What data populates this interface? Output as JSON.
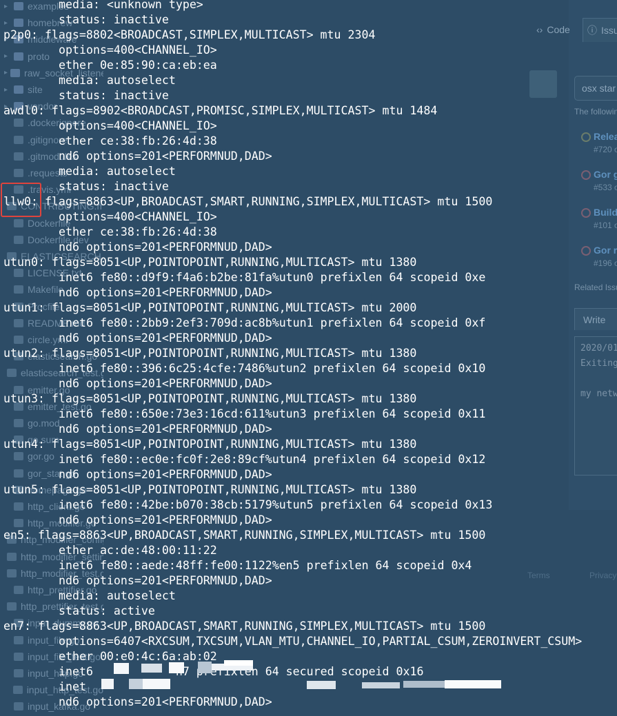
{
  "background": {
    "file_tree": [
      {
        "label": "examples",
        "type": "folder"
      },
      {
        "label": "homebrew",
        "type": "folder"
      },
      {
        "label": "middleware",
        "type": "folder"
      },
      {
        "label": "proto",
        "type": "folder"
      },
      {
        "label": "raw_socket_listener",
        "type": "folder"
      },
      {
        "label": "site",
        "type": "folder"
      },
      {
        "label": "vendor",
        "type": "folder"
      },
      {
        "label": ".dockerignore",
        "type": "file"
      },
      {
        "label": ".gitignore",
        "type": "file"
      },
      {
        "label": ".gitmodules",
        "type": "file"
      },
      {
        "label": ".requests",
        "type": "file"
      },
      {
        "label": ".travis.yml",
        "type": "file"
      },
      {
        "label": "CONTRIBUTING.md",
        "type": "file"
      },
      {
        "label": "Dockerfile",
        "type": "file"
      },
      {
        "label": "Dockerfile.dev",
        "type": "file"
      },
      {
        "label": "ELASTICSEARCH.md",
        "type": "file"
      },
      {
        "label": "LICENSE.txt",
        "type": "file"
      },
      {
        "label": "Makefile",
        "type": "file"
      },
      {
        "label": "Procfile",
        "type": "file"
      },
      {
        "label": "README.md",
        "type": "file"
      },
      {
        "label": "circle.yml",
        "type": "file"
      },
      {
        "label": "elasticsearch.go",
        "type": "file"
      },
      {
        "label": "elasticsearch_test.go",
        "type": "file"
      },
      {
        "label": "emitter.go",
        "type": "file"
      },
      {
        "label": "emitter_test.go",
        "type": "file"
      },
      {
        "label": "go.mod",
        "type": "file"
      },
      {
        "label": "go.sum",
        "type": "file"
      },
      {
        "label": "gor.go",
        "type": "file"
      },
      {
        "label": "gor_stat.go",
        "type": "file"
      },
      {
        "label": "homepage.go",
        "type": "file"
      },
      {
        "label": "http_client.go",
        "type": "file"
      },
      {
        "label": "http_modifier.go",
        "type": "file"
      },
      {
        "label": "http_modifier_config.go",
        "type": "file"
      },
      {
        "label": "http_modifier_settings.go",
        "type": "file"
      },
      {
        "label": "http_modifier_test.go",
        "type": "file"
      },
      {
        "label": "http_prettifier.go",
        "type": "file"
      },
      {
        "label": "http_prettifier_test.go",
        "type": "file"
      },
      {
        "label": "input_dummy.go",
        "type": "file"
      },
      {
        "label": "input_file.go",
        "type": "file"
      },
      {
        "label": "input_file_test.go",
        "type": "file"
      },
      {
        "label": "input_http.go",
        "type": "file"
      },
      {
        "label": "input_http_test.go",
        "type": "file"
      },
      {
        "label": "input_kafka.go",
        "type": "file"
      },
      {
        "label": "input_kafka_test.go",
        "type": "file"
      }
    ],
    "tabs": {
      "code": "Code",
      "issues": "Issu"
    },
    "search_value": "osx star",
    "following_text": "The followin",
    "issues": [
      {
        "title": "Relea",
        "number": "#720 o",
        "state": "open"
      },
      {
        "title": "Gor g",
        "number": "#533 o",
        "state": "closed"
      },
      {
        "title": "Build",
        "number": "#101 o",
        "state": "closed"
      },
      {
        "title": "Gor re",
        "number": "#196 o",
        "state": "closed"
      }
    ],
    "related_text": "Related Issu",
    "write_tab": "Write",
    "comment_lines": [
      "2020/01",
      "Exiting",
      "",
      "my netw"
    ],
    "footer": {
      "terms": "Terms",
      "privacy": "Privacy"
    }
  },
  "terminal": {
    "lines": [
      {
        "indent": true,
        "text": "media: <unknown type>"
      },
      {
        "indent": true,
        "text": "status: inactive"
      },
      {
        "indent": false,
        "text": "p2p0: flags=8802<BROADCAST,SIMPLEX,MULTICAST> mtu 2304"
      },
      {
        "indent": true,
        "text": "options=400<CHANNEL_IO>"
      },
      {
        "indent": true,
        "text": "ether 0e:85:90:ca:eb:ea"
      },
      {
        "indent": true,
        "text": "media: autoselect"
      },
      {
        "indent": true,
        "text": "status: inactive"
      },
      {
        "indent": false,
        "text": "awdl0: flags=8902<BROADCAST,PROMISC,SIMPLEX,MULTICAST> mtu 1484"
      },
      {
        "indent": true,
        "text": "options=400<CHANNEL_IO>"
      },
      {
        "indent": true,
        "text": "ether ce:38:fb:26:4d:38"
      },
      {
        "indent": true,
        "text": "nd6 options=201<PERFORMNUD,DAD>"
      },
      {
        "indent": true,
        "text": "media: autoselect"
      },
      {
        "indent": true,
        "text": "status: inactive"
      },
      {
        "indent": false,
        "text": "llw0: flags=8863<UP,BROADCAST,SMART,RUNNING,SIMPLEX,MULTICAST> mtu 1500"
      },
      {
        "indent": true,
        "text": "options=400<CHANNEL_IO>"
      },
      {
        "indent": true,
        "text": "ether ce:38:fb:26:4d:38"
      },
      {
        "indent": true,
        "text": "nd6 options=201<PERFORMNUD,DAD>"
      },
      {
        "indent": false,
        "text": "utun0: flags=8051<UP,POINTOPOINT,RUNNING,MULTICAST> mtu 1380"
      },
      {
        "indent": true,
        "text": "inet6 fe80::d9f9:f4a6:b2be:81fa%utun0 prefixlen 64 scopeid 0xe"
      },
      {
        "indent": true,
        "text": "nd6 options=201<PERFORMNUD,DAD>"
      },
      {
        "indent": false,
        "text": "utun1: flags=8051<UP,POINTOPOINT,RUNNING,MULTICAST> mtu 2000"
      },
      {
        "indent": true,
        "text": "inet6 fe80::2bb9:2ef3:709d:ac8b%utun1 prefixlen 64 scopeid 0xf"
      },
      {
        "indent": true,
        "text": "nd6 options=201<PERFORMNUD,DAD>"
      },
      {
        "indent": false,
        "text": "utun2: flags=8051<UP,POINTOPOINT,RUNNING,MULTICAST> mtu 1380"
      },
      {
        "indent": true,
        "text": "inet6 fe80::396:6c25:4cfe:7486%utun2 prefixlen 64 scopeid 0x10"
      },
      {
        "indent": true,
        "text": "nd6 options=201<PERFORMNUD,DAD>"
      },
      {
        "indent": false,
        "text": "utun3: flags=8051<UP,POINTOPOINT,RUNNING,MULTICAST> mtu 1380"
      },
      {
        "indent": true,
        "text": "inet6 fe80::650e:73e3:16cd:611%utun3 prefixlen 64 scopeid 0x11"
      },
      {
        "indent": true,
        "text": "nd6 options=201<PERFORMNUD,DAD>"
      },
      {
        "indent": false,
        "text": "utun4: flags=8051<UP,POINTOPOINT,RUNNING,MULTICAST> mtu 1380"
      },
      {
        "indent": true,
        "text": "inet6 fe80::ec0e:fc0f:2e8:89cf%utun4 prefixlen 64 scopeid 0x12"
      },
      {
        "indent": true,
        "text": "nd6 options=201<PERFORMNUD,DAD>"
      },
      {
        "indent": false,
        "text": "utun5: flags=8051<UP,POINTOPOINT,RUNNING,MULTICAST> mtu 1380"
      },
      {
        "indent": true,
        "text": "inet6 fe80::42be:b070:38cb:5179%utun5 prefixlen 64 scopeid 0x13"
      },
      {
        "indent": true,
        "text": "nd6 options=201<PERFORMNUD,DAD>"
      },
      {
        "indent": false,
        "text": "en5: flags=8863<UP,BROADCAST,SMART,RUNNING,SIMPLEX,MULTICAST> mtu 1500"
      },
      {
        "indent": true,
        "text": "ether ac:de:48:00:11:22"
      },
      {
        "indent": true,
        "text": "inet6 fe80::aede:48ff:fe00:1122%en5 prefixlen 64 scopeid 0x4"
      },
      {
        "indent": true,
        "text": "nd6 options=201<PERFORMNUD,DAD>"
      },
      {
        "indent": true,
        "text": "media: autoselect"
      },
      {
        "indent": true,
        "text": "status: active"
      },
      {
        "indent": false,
        "text": "en7: flags=8863<UP,BROADCAST,SMART,RUNNING,SIMPLEX,MULTICAST> mtu 1500"
      },
      {
        "indent": true,
        "text": "options=6407<RXCSUM,TXCSUM,VLAN_MTU,CHANNEL_IO,PARTIAL_CSUM,ZEROINVERT_CSUM>"
      },
      {
        "indent": true,
        "text": "ether 00:e0:4c:6a:ab:02"
      },
      {
        "indent": true,
        "text": "inet6            n7 prefixlen 64 secured scopeid 0x16"
      },
      {
        "indent": true,
        "text": "inet"
      },
      {
        "indent": true,
        "text": "nd6 options=201<PERFORMNUD,DAD>"
      }
    ],
    "highlight_color": "#e0443d"
  }
}
